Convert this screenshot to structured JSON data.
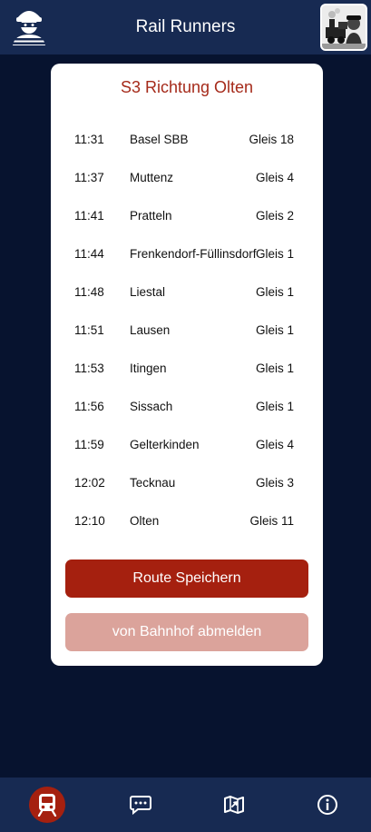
{
  "header": {
    "title": "Rail Runners",
    "left_icon": "robber-avatar-icon",
    "right_icon": "train-engineer-avatar-icon"
  },
  "route": {
    "title": "S3 Richtung Olten",
    "stops": [
      {
        "time": "11:31",
        "station": "Basel SBB",
        "track": "Gleis 18"
      },
      {
        "time": "11:37",
        "station": "Muttenz",
        "track": "Gleis 4"
      },
      {
        "time": "11:41",
        "station": "Pratteln",
        "track": "Gleis 2"
      },
      {
        "time": "11:44",
        "station": "Frenkendorf-Füllinsdorf",
        "track": "Gleis 1"
      },
      {
        "time": "11:48",
        "station": "Liestal",
        "track": "Gleis 1"
      },
      {
        "time": "11:51",
        "station": "Lausen",
        "track": "Gleis 1"
      },
      {
        "time": "11:53",
        "station": "Itingen",
        "track": "Gleis 1"
      },
      {
        "time": "11:56",
        "station": "Sissach",
        "track": "Gleis 1"
      },
      {
        "time": "11:59",
        "station": "Gelterkinden",
        "track": "Gleis 4"
      },
      {
        "time": "12:02",
        "station": "Tecknau",
        "track": "Gleis 3"
      },
      {
        "time": "12:10",
        "station": "Olten",
        "track": "Gleis 11"
      }
    ],
    "save_label": "Route Speichern",
    "logout_label": "von Bahnhof abmelden"
  },
  "nav": {
    "items": [
      {
        "icon": "train-icon",
        "active": true
      },
      {
        "icon": "chat-icon",
        "active": false
      },
      {
        "icon": "map-icon",
        "active": false
      },
      {
        "icon": "info-icon",
        "active": false
      }
    ]
  },
  "colors": {
    "header_bg": "#172a52",
    "page_bg": "#07132f",
    "accent": "#a5200f",
    "accent_light": "#dba39b",
    "title_red": "#a52a1a"
  }
}
